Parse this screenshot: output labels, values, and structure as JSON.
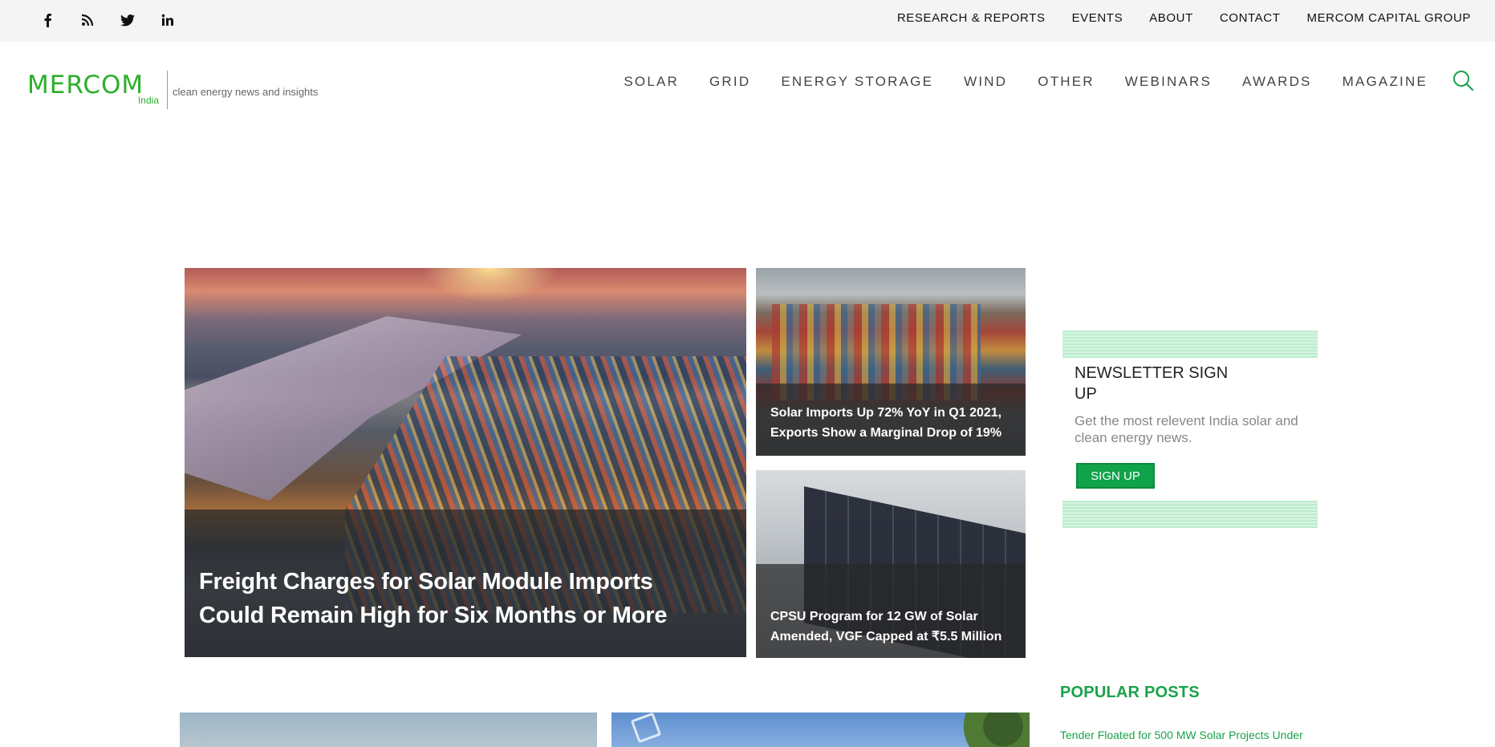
{
  "topbar": {
    "social": [
      {
        "icon": "facebook-icon"
      },
      {
        "icon": "rss-icon"
      },
      {
        "icon": "twitter-icon"
      },
      {
        "icon": "linkedin-icon"
      }
    ],
    "links": [
      "RESEARCH & REPORTS",
      "EVENTS",
      "ABOUT",
      "CONTACT",
      "MERCOM CAPITAL GROUP"
    ]
  },
  "header": {
    "logo_word": "MERCOM",
    "logo_sub": "India",
    "tagline": "clean energy news and insights",
    "nav": [
      "SOLAR",
      "GRID",
      "ENERGY STORAGE",
      "WIND",
      "OTHER",
      "WEBINARS",
      "AWARDS",
      "MAGAZINE"
    ],
    "search_icon": "search-icon"
  },
  "featured": {
    "main": {
      "title": "Freight Charges for Solar Module Imports Could Remain High for Six Months or More"
    },
    "side": [
      {
        "title": "Solar Imports Up 72% YoY in Q1 2021, Exports Show a Marginal Drop of 19%"
      },
      {
        "title": "CPSU Program for 12 GW of Solar Amended, VGF Capped at ₹5.5 Million"
      }
    ]
  },
  "newsletter": {
    "title": "NEWSLETTER SIGN UP",
    "description": "Get the most relevent India solar and clean energy news.",
    "button": "SIGN UP"
  },
  "popular": {
    "heading": "POPULAR POSTS",
    "items": [
      "Tender Floated for 500 MW Solar Projects Under"
    ]
  },
  "colors": {
    "brand_green": "#2bb02b",
    "accent_green": "#10a34a",
    "topbar_bg": "#f4f4f4"
  }
}
